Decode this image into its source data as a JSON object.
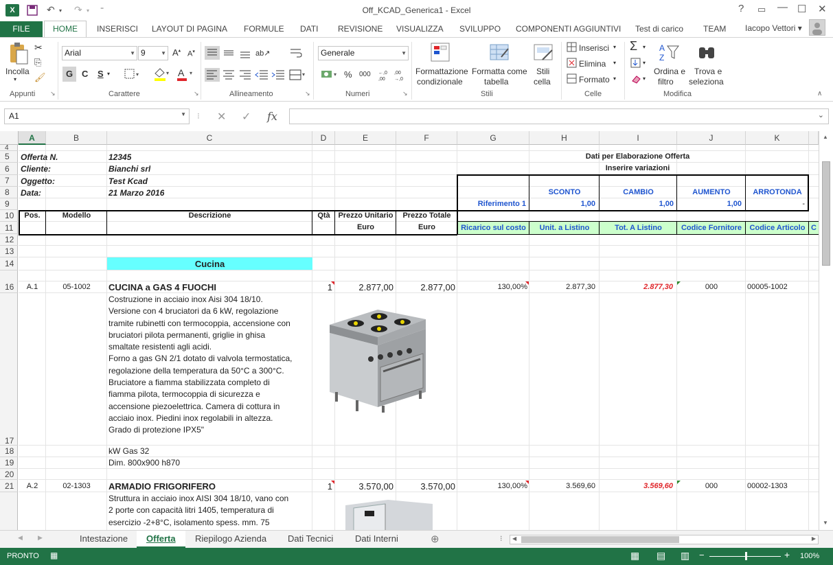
{
  "window": {
    "title": "Off_KCAD_Generica1 - Excel",
    "app_icon": "X",
    "help": "?",
    "ribbon_toggle": "▭",
    "minimize": "—",
    "maximize": "☐",
    "close": "✕"
  },
  "ribbon_tabs": {
    "file": "FILE",
    "items": [
      "HOME",
      "INSERISCI",
      "LAYOUT DI PAGINA",
      "FORMULE",
      "DATI",
      "REVISIONE",
      "VISUALIZZA",
      "SVILUPPO",
      "COMPONENTI AGGIUNTIVI",
      "Test di carico",
      "TEAM"
    ],
    "active": "HOME",
    "user": "Iacopo Vettori ▾"
  },
  "ribbon": {
    "appunti": {
      "label": "Appunti",
      "incolla": "Incolla"
    },
    "carattere": {
      "label": "Carattere",
      "font": "Arial",
      "size": "9",
      "bold": "G",
      "italic": "C",
      "underline": "S"
    },
    "allineamento": {
      "label": "Allineamento"
    },
    "numeri": {
      "label": "Numeri",
      "format": "Generale",
      "percent": "%",
      "thousands": "000"
    },
    "stili": {
      "label": "Stili",
      "cond1": "Formattazione",
      "cond2": "condizionale",
      "table1": "Formatta come",
      "table2": "tabella",
      "cell1": "Stili",
      "cell2": "cella"
    },
    "celle": {
      "label": "Celle",
      "insert": "Inserisci",
      "delete": "Elimina",
      "format": "Formato"
    },
    "modifica": {
      "label": "Modifica",
      "sort1": "Ordina e",
      "sort2": "filtro",
      "find1": "Trova e",
      "find2": "seleziona"
    }
  },
  "formula_bar": {
    "name_box": "A1",
    "cancel": "✕",
    "enter": "✓",
    "fx": "fx",
    "value": ""
  },
  "columns": [
    "A",
    "B",
    "C",
    "D",
    "E",
    "F",
    "G",
    "H",
    "I",
    "J",
    "K"
  ],
  "rows": [
    "4",
    "5",
    "6",
    "7",
    "8",
    "9",
    "10",
    "11",
    "12",
    "13",
    "14",
    "16",
    "17",
    "18",
    "19",
    "20",
    "21"
  ],
  "header_info": {
    "offerta_label": "Offerta N.",
    "offerta_value": "12345",
    "cliente_label": "Cliente:",
    "cliente_value": "Bianchi srl",
    "oggetto_label": "Oggetto:",
    "oggetto_value": "Test Kcad",
    "data_label": "Data:",
    "data_value": "21 Marzo 2016"
  },
  "elaborazione": {
    "title": "Dati per Elaborazione Offerta",
    "subtitle": "Inserire variazioni",
    "sconto": "SCONTO",
    "cambio": "CAMBIO",
    "aumento": "AUMENTO",
    "arrotonda": "ARROTONDA",
    "riferimento": "Riferimento 1",
    "sconto_val": "1,00",
    "cambio_val": "1,00",
    "aumento_val": "1,00",
    "arrotonda_val": "-"
  },
  "table_headers": {
    "pos": "Pos.",
    "modello": "Modello",
    "descrizione": "Descrizione",
    "qta": "Qtà",
    "prezzo_unitario": "Prezzo Unitario",
    "euro1": "Euro",
    "prezzo_totale": "Prezzo Totale",
    "euro2": "Euro",
    "ricarico": "Ricarico sul costo",
    "unit_listino": "Unit. a Listino",
    "tot_listino": "Tot. A Listino",
    "codice_fornitore": "Codice Fornitore",
    "codice_articolo": "Codice Articolo",
    "extra": "C"
  },
  "section": {
    "title": "Cucina"
  },
  "items": [
    {
      "pos": "A.1",
      "modello": "05-1002",
      "name": "CUCINA a GAS 4 FUOCHI",
      "qta": "1",
      "prezzo_unitario": "2.877,00",
      "prezzo_totale": "2.877,00",
      "ricarico": "130,00%",
      "unit_listino": "2.877,30",
      "tot_listino": "2.877,30",
      "codice_fornitore": "000",
      "codice_articolo": "00005-1002",
      "description": [
        "Costruzione in acciaio inox Aisi 304 18/10.",
        "Versione con 4 bruciatori da 6 kW, regolazione",
        "tramite rubinetti con termocoppia, accensione con",
        "bruciatori pilota permanenti, griglie in ghisa",
        "smaltate resistenti agli acidi.",
        "Forno a gas GN 2/1 dotato di valvola termostatica,",
        "regolazione della temperatura da 50°C a 300°C.",
        "Bruciatore a fiamma stabilizzata completo di",
        "fiamma pilota, termocoppia di sicurezza e",
        "accensione piezoelettrica. Camera di cottura in",
        "acciaio inox. Piedini inox regolabili in altezza.",
        "Grado di protezione IPX5\""
      ],
      "extra1": "kW Gas 32",
      "extra2": "Dim. 800x900 h870"
    },
    {
      "pos": "A.2",
      "modello": "02-1303",
      "name": "ARMADIO FRIGORIFERO",
      "qta": "1",
      "prezzo_unitario": "3.570,00",
      "prezzo_totale": "3.570,00",
      "ricarico": "130,00%",
      "unit_listino": "3.569,60",
      "tot_listino": "3.569,60",
      "codice_fornitore": "000",
      "codice_articolo": "00002-1303",
      "description": [
        "Struttura in acciaio inox AISI 304 18/10, vano con",
        "2 porte con capacità litri 1405, temperatura di",
        "esercizio -2+8°C, isolamento spess. mm. 75",
        "…"
      ]
    }
  ],
  "sheets": [
    "Intestazione",
    "Offerta",
    "Riepilogo Azienda",
    "Dati Tecnici",
    "Dati Interni"
  ],
  "active_sheet": "Offerta",
  "status": {
    "ready": "PRONTO",
    "zoom": "100%"
  },
  "colors": {
    "excel_green": "#217346",
    "cyan_fill": "#66ffff",
    "light_green_fill": "#ccffcc",
    "blue_text": "#1f55cf",
    "red_text": "#e0262b"
  }
}
